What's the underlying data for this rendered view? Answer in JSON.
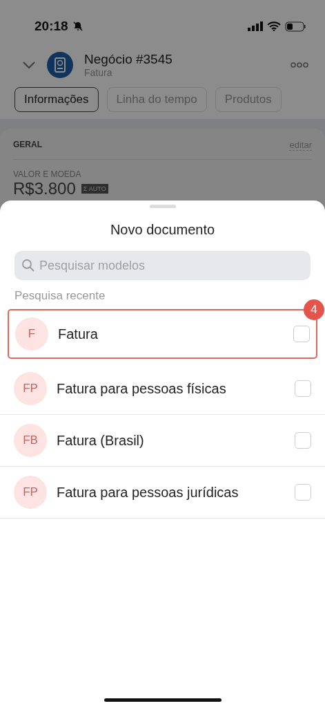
{
  "status_bar": {
    "time": "20:18"
  },
  "header": {
    "title": "Negócio #3545",
    "subtitle": "Fatura"
  },
  "tabs": [
    {
      "label": "Informações",
      "selected": true
    },
    {
      "label": "Linha do tempo",
      "selected": false
    },
    {
      "label": "Produtos",
      "selected": false
    }
  ],
  "card": {
    "section": "GERAL",
    "edit": "editar",
    "field_label": "VALOR E MOEDA",
    "value": "R$3.800",
    "value_badge": "Σ AUTO"
  },
  "sheet": {
    "title": "Novo documento",
    "search": {
      "placeholder": "Pesquisar modelos"
    },
    "section": "Pesquisa recente",
    "items": [
      {
        "initials": "F",
        "name": "Fatura",
        "checked": false,
        "highlighted": true,
        "badge": "4"
      },
      {
        "initials": "FP",
        "name": "Fatura para pessoas físicas",
        "checked": false,
        "highlighted": false
      },
      {
        "initials": "FB",
        "name": "Fatura (Brasil)",
        "checked": false,
        "highlighted": false
      },
      {
        "initials": "FP",
        "name": "Fatura para pessoas jurídicas",
        "checked": false,
        "highlighted": false
      }
    ]
  }
}
